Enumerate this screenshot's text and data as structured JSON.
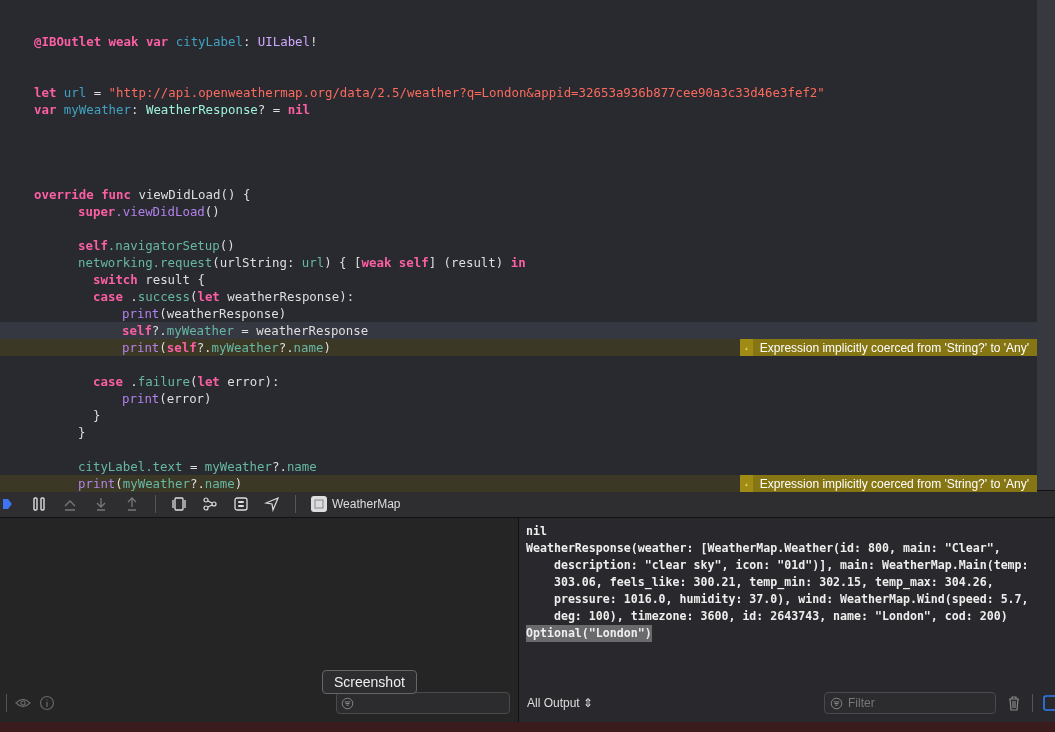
{
  "editor": {
    "lines": [
      {
        "kind": "code",
        "current": false,
        "tokens": [
          {
            "kind": "kw",
            "text": "@IBOutlet weak var"
          },
          {
            "kind": "decl",
            "text": " cityLabel"
          },
          {
            "kind": "plain",
            "text": ":"
          },
          {
            "kind": "type",
            "text": " UILabel"
          },
          {
            "kind": "plain",
            "text": "!"
          }
        ]
      },
      {
        "kind": "blank",
        "current": false
      },
      {
        "kind": "blank",
        "current": false
      },
      {
        "kind": "code",
        "current": false,
        "tokens": [
          {
            "kind": "kw",
            "text": "let"
          },
          {
            "kind": "decl",
            "text": " url"
          },
          {
            "kind": "plain",
            "text": " ="
          },
          {
            "kind": "str",
            "text": " \"http://api.openweathermap.org/data/2.5/weather?q=London&appid=32653a936b877cee90a3c33d46e3fef2\""
          }
        ]
      },
      {
        "kind": "code",
        "current": false,
        "tokens": [
          {
            "kind": "kw",
            "text": "var"
          },
          {
            "kind": "decl",
            "text": " myWeather"
          },
          {
            "kind": "plain",
            "text": ":"
          },
          {
            "kind": "ptype",
            "text": " WeatherResponse"
          },
          {
            "kind": "plain",
            "text": "? ="
          },
          {
            "kind": "kw",
            "text": " nil"
          }
        ]
      },
      {
        "kind": "blank",
        "current": false
      },
      {
        "kind": "blank",
        "current": false
      },
      {
        "kind": "blank",
        "current": false
      },
      {
        "kind": "blank",
        "current": false
      },
      {
        "kind": "code",
        "current": false,
        "tokens": [
          {
            "kind": "kw",
            "text": "override func"
          },
          {
            "kind": "plain",
            "text": " viewDidLoad() {"
          }
        ],
        "children": [
          {
            "kind": "code",
            "current": false,
            "tokens": [
              {
                "kind": "kw",
                "text": "super"
              },
              {
                "kind": "func",
                "text": ".viewDidLoad"
              },
              {
                "kind": "plain",
                "text": "()"
              }
            ]
          },
          {
            "kind": "blank",
            "current": false
          },
          {
            "kind": "code",
            "current": false,
            "tokens": [
              {
                "kind": "kw",
                "text": "self"
              },
              {
                "kind": "pref",
                "text": ".navigatorSetup"
              },
              {
                "kind": "plain",
                "text": "()"
              }
            ]
          },
          {
            "kind": "code",
            "current": false,
            "tokens": [
              {
                "kind": "pref",
                "text": "networking.request"
              },
              {
                "kind": "plain",
                "text": "(urlString:"
              },
              {
                "kind": "pref",
                "text": " url"
              },
              {
                "kind": "plain",
                "text": ") { ["
              },
              {
                "kind": "kw",
                "text": "weak self"
              },
              {
                "kind": "plain",
                "text": "] (result)"
              },
              {
                "kind": "kw",
                "text": " in"
              }
            ],
            "children": [
              {
                "kind": "code",
                "current": false,
                "tokens": [
                  {
                    "kind": "kw",
                    "text": "switch"
                  },
                  {
                    "kind": "plain",
                    "text": " result {"
                  }
                ],
                "children": [
                  {
                    "kind": "code",
                    "current": false,
                    "tokens": [
                      {
                        "kind": "kw",
                        "text": "case"
                      },
                      {
                        "kind": "plain",
                        "text": " ."
                      },
                      {
                        "kind": "pref",
                        "text": "success"
                      },
                      {
                        "kind": "plain",
                        "text": "("
                      },
                      {
                        "kind": "kw",
                        "text": "let"
                      },
                      {
                        "kind": "plain",
                        "text": " weatherResponse):"
                      }
                    ],
                    "children": [
                      {
                        "kind": "code",
                        "current": false,
                        "tokens": [
                          {
                            "kind": "func",
                            "text": "print"
                          },
                          {
                            "kind": "plain",
                            "text": "(weatherResponse)"
                          }
                        ]
                      },
                      {
                        "kind": "code",
                        "current": true,
                        "tokens": [
                          {
                            "kind": "kw",
                            "text": "self"
                          },
                          {
                            "kind": "plain",
                            "text": "?."
                          },
                          {
                            "kind": "pref",
                            "text": "myWeather"
                          },
                          {
                            "kind": "plain",
                            "text": " = weatherResponse"
                          }
                        ]
                      },
                      {
                        "kind": "code",
                        "current": false,
                        "warning": "Expression implicitly coerced from 'String?' to 'Any'",
                        "tokens": [
                          {
                            "kind": "func",
                            "text": "print"
                          },
                          {
                            "kind": "plain",
                            "text": "("
                          },
                          {
                            "kind": "kw",
                            "text": "self"
                          },
                          {
                            "kind": "plain",
                            "text": "?."
                          },
                          {
                            "kind": "pref",
                            "text": "myWeather"
                          },
                          {
                            "kind": "plain",
                            "text": "?."
                          },
                          {
                            "kind": "pref",
                            "text": "name"
                          },
                          {
                            "kind": "plain",
                            "text": ")"
                          }
                        ]
                      },
                      {
                        "kind": "blank",
                        "current": false
                      }
                    ]
                  },
                  {
                    "kind": "code",
                    "current": false,
                    "tokens": [
                      {
                        "kind": "kw",
                        "text": "case"
                      },
                      {
                        "kind": "plain",
                        "text": " ."
                      },
                      {
                        "kind": "pref",
                        "text": "failure"
                      },
                      {
                        "kind": "plain",
                        "text": "("
                      },
                      {
                        "kind": "kw",
                        "text": "let"
                      },
                      {
                        "kind": "plain",
                        "text": " error):"
                      }
                    ],
                    "children": [
                      {
                        "kind": "code",
                        "current": false,
                        "tokens": [
                          {
                            "kind": "func",
                            "text": "print"
                          },
                          {
                            "kind": "plain",
                            "text": "(error)"
                          }
                        ]
                      }
                    ]
                  }
                ]
              },
              {
                "kind": "code",
                "current": false,
                "tokens": [
                  {
                    "kind": "plain",
                    "text": "}"
                  }
                ]
              }
            ]
          },
          {
            "kind": "code",
            "current": false,
            "tokens": [
              {
                "kind": "plain",
                "text": "}"
              }
            ]
          },
          {
            "kind": "blank",
            "current": false
          },
          {
            "kind": "code",
            "current": false,
            "tokens": [
              {
                "kind": "pref",
                "text": "cityLabel.text"
              },
              {
                "kind": "plain",
                "text": " ="
              },
              {
                "kind": "pref",
                "text": " myWeather"
              },
              {
                "kind": "plain",
                "text": "?."
              },
              {
                "kind": "pref",
                "text": "name"
              }
            ]
          },
          {
            "kind": "code",
            "current": false,
            "warning": "Expression implicitly coerced from 'String?' to 'Any'",
            "tokens": [
              {
                "kind": "func",
                "text": "print"
              },
              {
                "kind": "plain",
                "text": "("
              },
              {
                "kind": "pref",
                "text": "myWeather"
              },
              {
                "kind": "plain",
                "text": "?."
              },
              {
                "kind": "pref",
                "text": "name"
              },
              {
                "kind": "plain",
                "text": ")"
              }
            ]
          }
        ]
      }
    ]
  },
  "debug_bar": {
    "target": "WeatherMap"
  },
  "console": {
    "lines": [
      {
        "selected": false,
        "text": "nil"
      },
      {
        "selected": false,
        "text": "WeatherResponse(weather: [WeatherMap.Weather(id: 800, main: \"Clear\",\n    description: \"clear sky\", icon: \"01d\")], main: WeatherMap.Main(temp:\n    303.06, feels_like: 300.21, temp_min: 302.15, temp_max: 304.26,\n    pressure: 1016.0, humidity: 37.0), wind: WeatherMap.Wind(speed: 5.7,\n    deg: 100), timezone: 3600, id: 2643743, name: \"London\", cod: 200)"
      },
      {
        "selected": true,
        "text": "Optional(\"London\")"
      }
    ],
    "output_menu": "All Output ⇕",
    "filter": {
      "placeholder": "Filter"
    }
  },
  "tooltip": "Screenshot"
}
